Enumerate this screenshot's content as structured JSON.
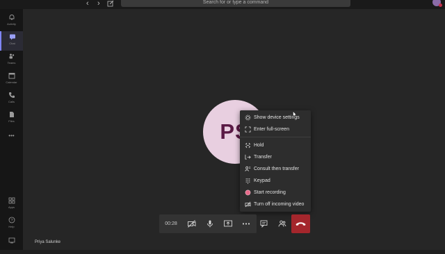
{
  "header": {
    "search_placeholder": "Search for or type a command"
  },
  "rail": {
    "items": [
      {
        "label": "Activity",
        "icon": "bell-icon"
      },
      {
        "label": "Chat",
        "icon": "chat-icon"
      },
      {
        "label": "Teams",
        "icon": "teams-icon"
      },
      {
        "label": "Calendar",
        "icon": "calendar-icon"
      },
      {
        "label": "Calls",
        "icon": "phone-icon"
      },
      {
        "label": "Files",
        "icon": "file-icon"
      }
    ],
    "more": "•••",
    "bottom": [
      {
        "label": "Apps",
        "icon": "apps-icon"
      },
      {
        "label": "Help",
        "icon": "help-icon"
      }
    ],
    "accent": "#7f85f5"
  },
  "call": {
    "avatar_initials": "PS",
    "caller_name": "Priya Salunke",
    "timer": "00:28",
    "hangup_color": "#a4262c"
  },
  "menu": {
    "items": [
      {
        "label": "Show device settings",
        "icon": "gear-icon"
      },
      {
        "label": "Enter full-screen",
        "icon": "fullscreen-icon"
      },
      {
        "label": "Hold",
        "icon": "hold-icon"
      },
      {
        "label": "Transfer",
        "icon": "transfer-icon"
      },
      {
        "label": "Consult then transfer",
        "icon": "consult-icon"
      },
      {
        "label": "Keypad",
        "icon": "keypad-icon"
      },
      {
        "label": "Start recording",
        "icon": "record-icon"
      },
      {
        "label": "Turn off incoming video",
        "icon": "video-off-icon"
      }
    ]
  }
}
